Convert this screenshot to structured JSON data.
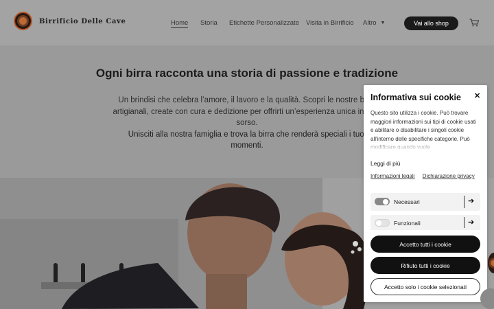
{
  "header": {
    "brand": "Birrificio Delle Cave",
    "nav": [
      {
        "label": "Home"
      },
      {
        "label": "Storia"
      },
      {
        "label": "Etichette Personalizzate"
      },
      {
        "label": "Visita in Birrificio"
      },
      {
        "label": "Altro"
      }
    ],
    "shop_button": "Vai allo shop",
    "icons": {
      "logo": "brewery-logo-icon",
      "more": "caret-down-icon",
      "cart": "cart-icon"
    }
  },
  "hero": {
    "title": "Ogni birra racconta una storia di passione e tradizione",
    "desc_line1": "Un brindisi che celebra l’amore, il lavoro e la qualità. Scopri le nostre birre",
    "desc_line2": "artigianali, create con cura e dedizione per offrirti un’esperienza unica in ogni",
    "desc_line3": "sorso.",
    "desc_line4": "Unisciti alla nostra famiglia e trova la birra che renderà speciali i tuoi",
    "desc_line5": "momenti."
  },
  "cookie": {
    "title": "Informativa sui cookie",
    "close_icon": "close-icon",
    "text": "Questo sito utilizza i cookie. Può trovare maggiori informazioni sui tipi di cookie usati e abilitare o disabilitare i singoli cookie all'interno delle specifiche categorie. Può modificare quando vuole",
    "learn_more": "Leggi di più",
    "link_legal": "Informazioni legali",
    "link_privacy": "Dichiarazione privacy",
    "toggles": [
      {
        "label": "Necessari",
        "on": true
      },
      {
        "label": "Funzionali",
        "on": false
      }
    ],
    "accept_all": "Accetto tutti i cookie",
    "reject_all": "Rifiuto tutti i cookie",
    "accept_selected": "Accetto solo i cookie selezionati"
  },
  "colors": {
    "overlay": "#9a9a9a",
    "panel": "#ffffff",
    "button_dark": "#111111"
  }
}
